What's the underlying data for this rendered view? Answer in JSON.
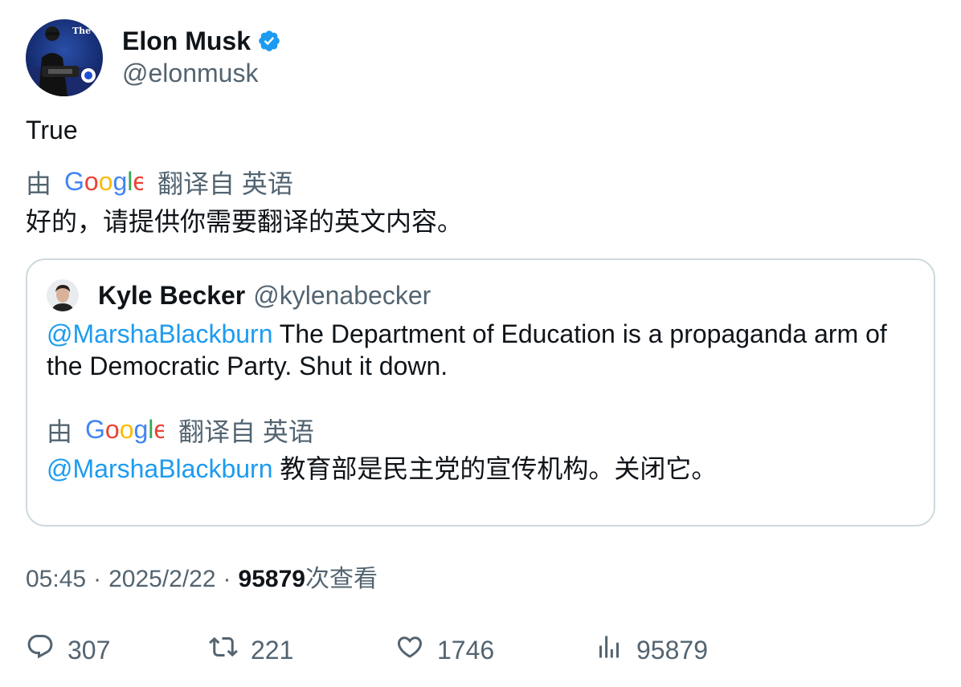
{
  "author": {
    "display_name": "Elon Musk",
    "handle": "@elonmusk",
    "verified": true,
    "avatar_icon": "avatar-photo",
    "avatar_caption": "The Dogefa"
  },
  "tweet": {
    "text": "True",
    "translation": {
      "by_label": "由",
      "provider": "Google",
      "from_label": "翻译自 英语",
      "text": "好的，请提供你需要翻译的英文内容。"
    }
  },
  "quoted": {
    "display_name": "Kyle Becker",
    "handle": "@kylenabecker",
    "mention": "@MarshaBlackburn",
    "text": " The Department of Education is a propaganda arm of the Democratic Party. Shut it down.",
    "translation": {
      "by_label": "由",
      "provider": "Google",
      "from_label": "翻译自 英语",
      "mention": "@MarshaBlackburn",
      "text": " 教育部是民主党的宣传机构。关闭它。"
    }
  },
  "meta": {
    "time": "05:45",
    "separator": "·",
    "date": "2025/2/22",
    "views_count": "95879",
    "views_label": "次查看"
  },
  "actions": {
    "replies": "307",
    "retweets": "221",
    "likes": "1746",
    "views": "95879"
  },
  "colors": {
    "text": "#0f1419",
    "secondary": "#536471",
    "accent": "#1d9bf0",
    "border": "#cfd9de"
  }
}
